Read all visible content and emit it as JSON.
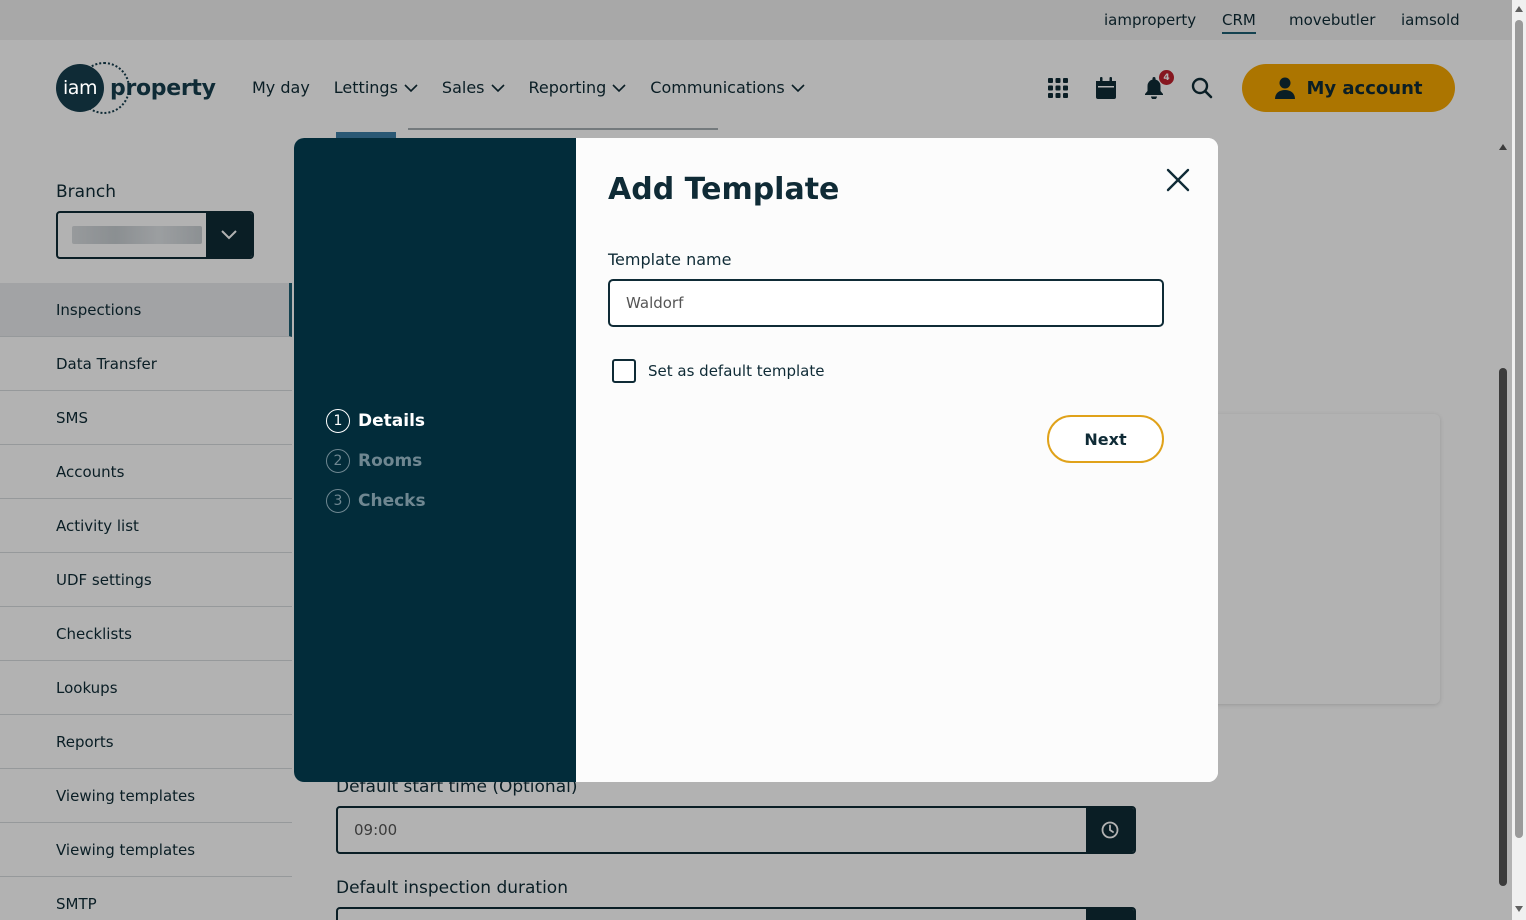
{
  "top_links": {
    "iamproperty": "iamproperty",
    "crm": "CRM",
    "movebutler": "movebutler",
    "iamsold": "iamsold"
  },
  "logo": {
    "circle_text": "iam",
    "text": "property"
  },
  "nav": {
    "my_day": "My day",
    "lettings": "Lettings",
    "sales": "Sales",
    "reporting": "Reporting",
    "communications": "Communications"
  },
  "header": {
    "notification_count": "4",
    "account_label": "My account",
    "icons": [
      "apps-grid-icon",
      "calendar-icon",
      "bell-icon",
      "search-icon",
      "user-icon"
    ]
  },
  "sidebar": {
    "branch_label": "Branch",
    "items": [
      {
        "label": "Inspections",
        "active": true
      },
      {
        "label": "Data Transfer"
      },
      {
        "label": "SMS"
      },
      {
        "label": "Accounts"
      },
      {
        "label": "Activity list"
      },
      {
        "label": "UDF settings"
      },
      {
        "label": "Checklists"
      },
      {
        "label": "Lookups"
      },
      {
        "label": "Reports"
      },
      {
        "label": "Viewing templates"
      },
      {
        "label": "Viewing templates"
      },
      {
        "label": "SMTP"
      }
    ]
  },
  "main": {
    "start_time_label": "Default start time (Optional)",
    "start_time_value": "09:00",
    "duration_label": "Default inspection duration"
  },
  "modal": {
    "title": "Add Template",
    "steps": [
      {
        "num": "1",
        "label": "Details",
        "state": "current"
      },
      {
        "num": "2",
        "label": "Rooms",
        "state": "pending"
      },
      {
        "num": "3",
        "label": "Checks",
        "state": "pending"
      }
    ],
    "template_name_label": "Template name",
    "template_name_value": "Waldorf",
    "default_checkbox_label": "Set as default template",
    "next_label": "Next"
  },
  "colors": {
    "dark_navy": "#022c3a",
    "accent_yellow": "#f7a800",
    "badge_red": "#c0212e"
  }
}
